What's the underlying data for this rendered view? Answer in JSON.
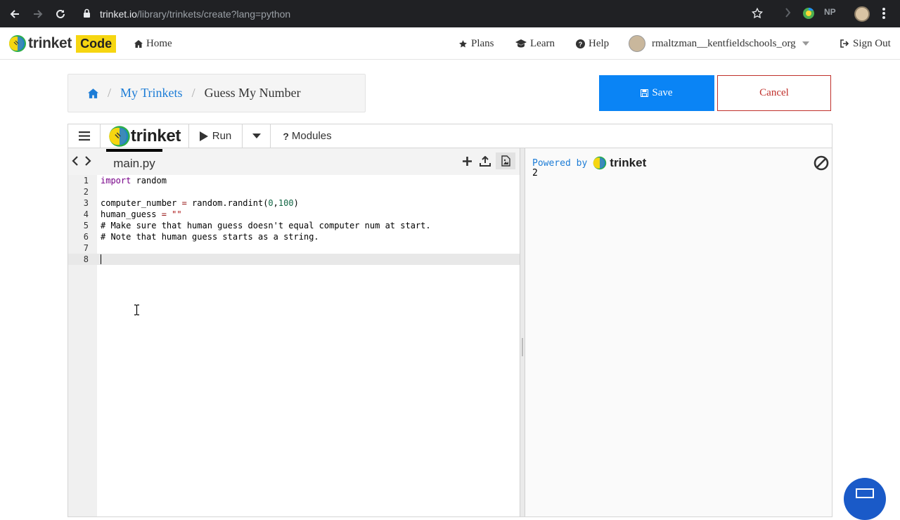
{
  "browser": {
    "url_host": "trinket.io",
    "url_path": "/library/trinkets/create?lang=python",
    "ext_label": "NP"
  },
  "header": {
    "logo_text": "trinket",
    "logo_badge": "Code",
    "nav": {
      "home": "Home",
      "plans": "Plans",
      "learn": "Learn",
      "help": "Help",
      "username": "rmaltzman__kentfieldschools_org",
      "sign_out": "Sign Out"
    }
  },
  "breadcrumb": {
    "parent": "My Trinkets",
    "separator": "/",
    "current": "Guess My Number"
  },
  "actions": {
    "save": "Save",
    "cancel": "Cancel"
  },
  "toolbar": {
    "brand": "trinket",
    "run": "Run",
    "modules": "Modules"
  },
  "file_tab": "main.py",
  "code_lines": [
    {
      "n": "1",
      "t": "import random"
    },
    {
      "n": "2",
      "t": ""
    },
    {
      "n": "3",
      "t": "computer_number = random.randint(0,100)"
    },
    {
      "n": "4",
      "t": "human_guess = \"\""
    },
    {
      "n": "5",
      "t": "# Make sure that human guess doesn't equal computer num at start."
    },
    {
      "n": "6",
      "t": "# Note that human guess starts as a string."
    },
    {
      "n": "7",
      "t": ""
    },
    {
      "n": "8",
      "t": ""
    }
  ],
  "output": {
    "powered_by": "Powered by",
    "brand": "trinket",
    "text": "2"
  },
  "colors": {
    "save_bg": "#0a84f5",
    "cancel_border": "#c0302b",
    "link": "#1c7cd6",
    "badge_bg": "#f6d611",
    "chrome_bg": "#202124"
  }
}
